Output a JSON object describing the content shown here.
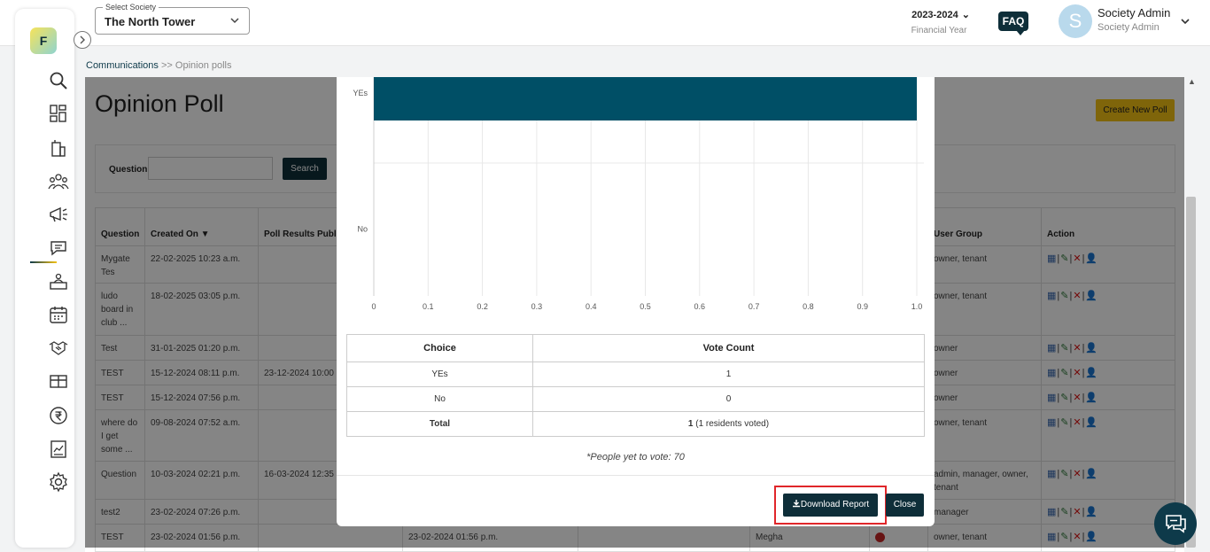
{
  "header": {
    "society_select_label": "Select Society",
    "society_selected": "The North Tower",
    "financial_year": "2023-2024",
    "financial_year_label": "Financial Year",
    "faq": "FAQ",
    "avatar_letter": "S",
    "user_name": "Society Admin",
    "user_role": "Society Admin"
  },
  "sidebar": {
    "logo_text": "F",
    "icons": [
      "search-icon",
      "dashboard-icon",
      "building-icon",
      "people-icon",
      "megaphone-icon",
      "chat-icon",
      "helpdesk-icon",
      "calendar-icon",
      "handshake-icon",
      "amenities-icon",
      "rupee-icon",
      "reports-icon",
      "settings-icon"
    ]
  },
  "breadcrumb": {
    "parent": "Communications",
    "sep": " >> ",
    "current": "Opinion polls"
  },
  "page": {
    "title": "Opinion Poll",
    "create_button": "Create New Poll",
    "question_label": "Question",
    "search_button": "Search"
  },
  "table": {
    "headers": [
      "Question",
      "Created On ▼",
      "Poll Results Publis",
      "",
      "",
      "",
      "",
      "User Group",
      "Action"
    ],
    "rows": [
      {
        "question": "Mygate Tes",
        "created": "22-02-2025 10:23 a.m.",
        "published": "",
        "col4": "",
        "col5": "",
        "col6": "",
        "status": "",
        "group": "owner, tenant"
      },
      {
        "question": "ludo board in club ...",
        "created": "18-02-2025 03:05 p.m.",
        "published": "",
        "col4": "",
        "col5": "",
        "col6": "",
        "status": "",
        "group": "owner, tenant"
      },
      {
        "question": "Test",
        "created": "31-01-2025 01:20 p.m.",
        "published": "",
        "col4": "",
        "col5": "",
        "col6": "",
        "status": "",
        "group": "owner"
      },
      {
        "question": "TEST",
        "created": "15-12-2024 08:11 p.m.",
        "published": "23-12-2024 10:00 a",
        "col4": "",
        "col5": "",
        "col6": "",
        "status": "",
        "group": "owner"
      },
      {
        "question": "TEST",
        "created": "15-12-2024 07:56 p.m.",
        "published": "",
        "col4": "",
        "col5": "",
        "col6": "",
        "status": "",
        "group": "owner"
      },
      {
        "question": "where do I get some ...",
        "created": "09-08-2024 07:52 a.m.",
        "published": "",
        "col4": "",
        "col5": "",
        "col6": "",
        "status": "",
        "group": "owner, tenant"
      },
      {
        "question": "Question",
        "created": "10-03-2024 02:21 p.m.",
        "published": "16-03-2024 12:35 a",
        "col4": "",
        "col5": "",
        "col6": "",
        "status": "",
        "group": "admin, manager, owner, tenant"
      },
      {
        "question": "test2",
        "created": "23-02-2024 07:26 p.m.",
        "published": "",
        "col4": "",
        "col5": "",
        "col6": "",
        "status": "",
        "group": "manager"
      },
      {
        "question": "TEST",
        "created": "23-02-2024 01:56 p.m.",
        "published": "",
        "col4": "23-02-2024 01:56 p.m.",
        "col5": "",
        "col6": "Megha",
        "status": "closed",
        "group": "owner, tenant"
      }
    ]
  },
  "modal": {
    "chart_data": {
      "type": "bar",
      "orientation": "horizontal",
      "categories": [
        "YEs",
        "No"
      ],
      "values": [
        1,
        0
      ],
      "xlim": [
        0,
        1.0
      ],
      "xticks": [
        "0",
        "0.1",
        "0.2",
        "0.3",
        "0.4",
        "0.5",
        "0.6",
        "0.7",
        "0.8",
        "0.9",
        "1.0"
      ],
      "grid": true,
      "bar_color": "#004f66"
    },
    "vote_table": {
      "headers": [
        "Choice",
        "Vote Count"
      ],
      "rows": [
        {
          "choice": "YEs",
          "count": "1"
        },
        {
          "choice": "No",
          "count": "0"
        }
      ],
      "total_label": "Total",
      "total_count": "1",
      "total_note": " (1 residents voted)"
    },
    "people_yet": "*People yet to vote: 70",
    "download_button": "Download Report",
    "close_button": "Close"
  }
}
